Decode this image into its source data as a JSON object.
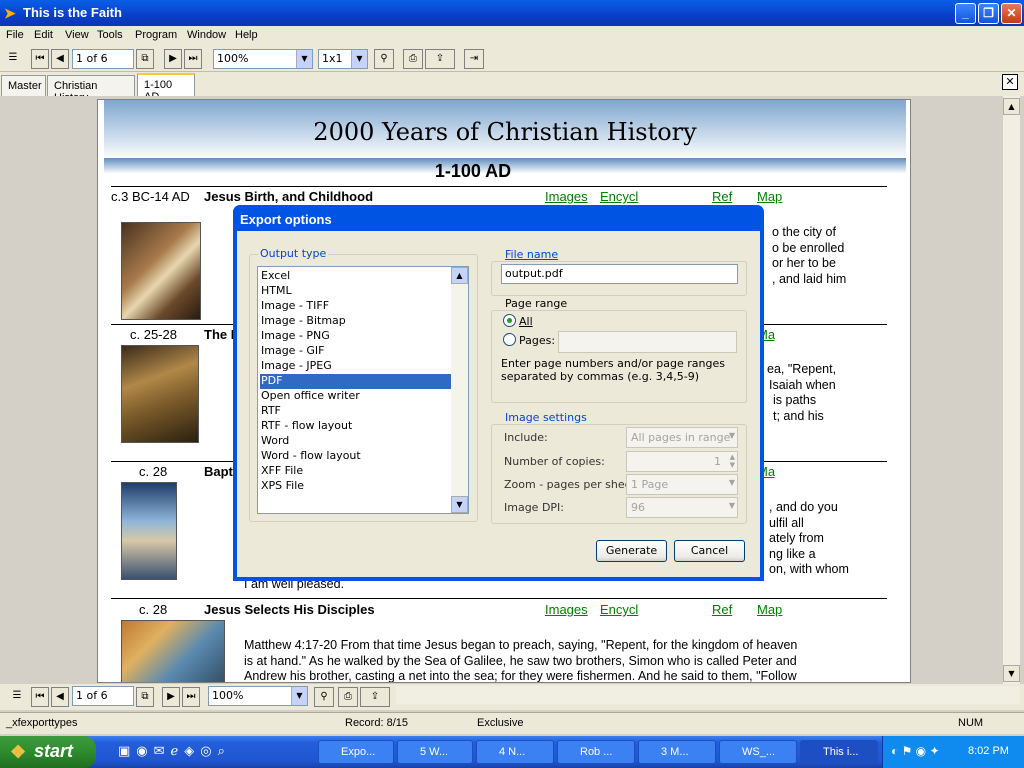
{
  "window": {
    "title": "This is the Faith"
  },
  "menu": [
    "File",
    "Edit",
    "View",
    "Tools",
    "Program",
    "Window",
    "Help"
  ],
  "toolbar": {
    "page_value": "1 of 6",
    "zoom": "100%",
    "layout": "1x1"
  },
  "tabs": [
    "Master",
    "Christian History",
    "1-100 AD"
  ],
  "page": {
    "title": "2000 Years of Christian History",
    "subtitle": "1-100 AD",
    "links": {
      "images": "Images",
      "encycl": "Encycl",
      "ref": "Ref",
      "map": "Map"
    },
    "entries": [
      {
        "date": "c.3 BC-14 AD",
        "title": "Jesus Birth, and Childhood",
        "lines": [
          "o the city of",
          "o be enrolled",
          "or her to be",
          ", and laid him"
        ]
      },
      {
        "date": "c. 25-28",
        "title": "The I",
        "lines": [
          "ea, \"Repent,",
          "Isaiah when",
          "is paths",
          "t; and his"
        ]
      },
      {
        "date": "c. 28",
        "title": "Bapti",
        "lines": [
          ", and do you",
          "ulfil all",
          "ately from",
          "ng like a",
          "on, with whom"
        ],
        "tail": "I am well pleased."
      },
      {
        "date": "c. 28",
        "title": "Jesus Selects His Disciples",
        "lines": [
          "Matthew 4:17-20 From that time Jesus began to preach, saying, \"Repent, for the kingdom of heaven",
          "is at hand.\" As he walked by the Sea of Galilee, he saw two brothers, Simon who is called Peter and",
          "Andrew his brother, casting a net into the sea; for they were fishermen. And he said to them, \"Follow"
        ]
      }
    ]
  },
  "bottom": {
    "page_value": "1 of 6",
    "zoom": "100%"
  },
  "status": {
    "left": "_xfexporttypes",
    "record": "Record: 8/15",
    "mode": "Exclusive",
    "num": "NUM"
  },
  "dialog": {
    "title": "Export options",
    "output_type_label": "Output type",
    "output_types": [
      "Excel",
      "HTML",
      "Image - TIFF",
      "Image - Bitmap",
      "Image - PNG",
      "Image - GIF",
      "Image - JPEG",
      "PDF",
      "Open office writer",
      "RTF",
      "RTF - flow layout",
      "Word",
      "Word - flow layout",
      "XFF File",
      "XPS File"
    ],
    "selected_type": "PDF",
    "file_name_label": "File name",
    "file_name": "output.pdf",
    "page_range_label": "Page range",
    "all_label": "All",
    "pages_label": "Pages:",
    "page_range_hint_1": "Enter page numbers and/or page ranges",
    "page_range_hint_2": "separated by commas (e.g. 3,4,5-9)",
    "image_settings_label": "Image settings",
    "include_label": "Include:",
    "include_value": "All pages in range",
    "copies_label": "Number of copies:",
    "copies_value": "1",
    "zoom_label": "Zoom - pages per sheet:",
    "zoom_value": "1 Page",
    "dpi_label": "Image DPI:",
    "dpi_value": "96",
    "generate_label": "Generate",
    "cancel_label": "Cancel"
  },
  "taskbar": {
    "start_label": "start",
    "tasks": [
      "Expo...",
      "5 W...",
      "4 N...",
      "Rob ...",
      "3 M...",
      "WS_...",
      "This i..."
    ],
    "clock": "8:02 PM"
  }
}
